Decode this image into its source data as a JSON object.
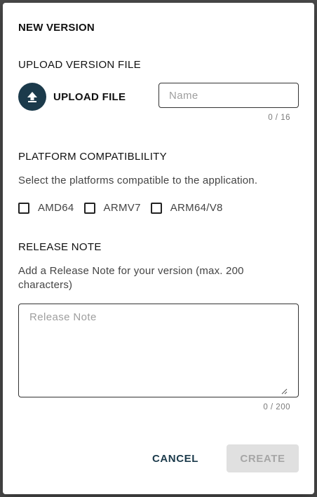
{
  "dialog": {
    "title": "NEW VERSION",
    "upload_section": {
      "title": "UPLOAD VERSION FILE",
      "upload_button_label": "UPLOAD FILE",
      "upload_icon": "upload-arrow-icon",
      "name_placeholder": "Name",
      "name_value": "",
      "name_counter": "0 / 16"
    },
    "platform_section": {
      "title": "PLATFORM COMPATIBLILITY",
      "description": "Select the platforms compatible to the application.",
      "options": [
        {
          "label": "AMD64",
          "checked": false
        },
        {
          "label": "ARMV7",
          "checked": false
        },
        {
          "label": "ARM64/V8",
          "checked": false
        }
      ]
    },
    "release_section": {
      "title": "RELEASE NOTE",
      "description": "Add a Release Note for your version (max. 200 characters)",
      "placeholder": "Release Note",
      "value": "",
      "counter": "0 / 200"
    },
    "actions": {
      "cancel_label": "CANCEL",
      "create_label": "CREATE",
      "create_disabled": true
    }
  },
  "colors": {
    "accent": "#1b3a4b",
    "disabled_bg": "#e0e0e0",
    "disabled_text": "#a6a6a6"
  }
}
